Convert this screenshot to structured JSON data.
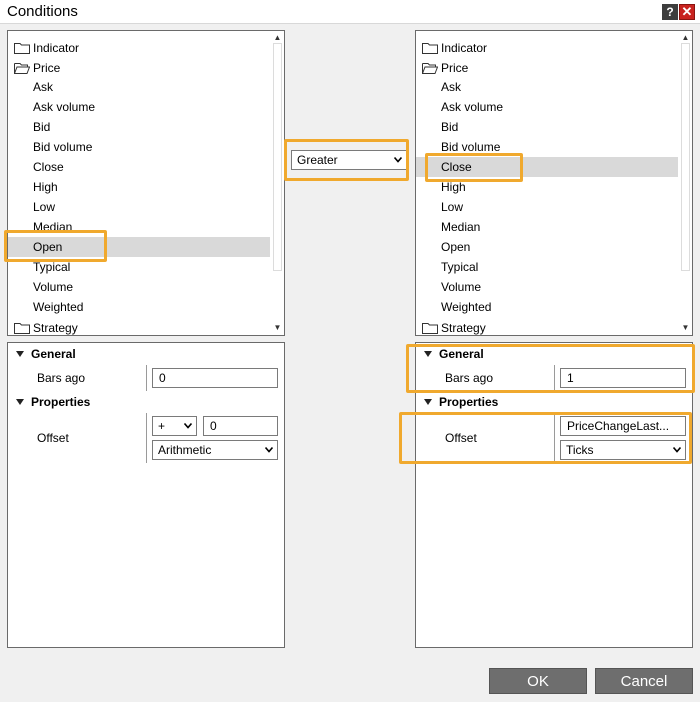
{
  "window": {
    "title": "Conditions",
    "help_glyph": "?",
    "close_glyph": "✕"
  },
  "left_tree": {
    "folders": {
      "indicator": "Indicator",
      "price": "Price",
      "strategy": "Strategy"
    },
    "items": [
      "Ask",
      "Ask volume",
      "Bid",
      "Bid volume",
      "Close",
      "High",
      "Low",
      "Median",
      "Open",
      "Typical",
      "Volume",
      "Weighted"
    ],
    "selected": "Open"
  },
  "right_tree": {
    "folders": {
      "indicator": "Indicator",
      "price": "Price",
      "strategy": "Strategy"
    },
    "items": [
      "Ask",
      "Ask volume",
      "Bid",
      "Bid volume",
      "Close",
      "High",
      "Low",
      "Median",
      "Open",
      "Typical",
      "Volume",
      "Weighted"
    ],
    "selected": "Close"
  },
  "operator": {
    "value": "Greater"
  },
  "left_props": {
    "general_header": "General",
    "bars_ago_label": "Bars ago",
    "bars_ago_value": "0",
    "properties_header": "Properties",
    "offset_label": "Offset",
    "offset_sign": "+",
    "offset_value": "0",
    "offset_type": "Arithmetic"
  },
  "right_props": {
    "general_header": "General",
    "bars_ago_label": "Bars ago",
    "bars_ago_value": "1",
    "properties_header": "Properties",
    "offset_label": "Offset",
    "offset_value": "PriceChangeLast...",
    "offset_type": "Ticks"
  },
  "buttons": {
    "ok": "OK",
    "cancel": "Cancel"
  },
  "colors": {
    "highlight": "#f0a92e",
    "selection": "#d9d9d9",
    "button": "#6e6e6e",
    "close": "#c8231f"
  }
}
